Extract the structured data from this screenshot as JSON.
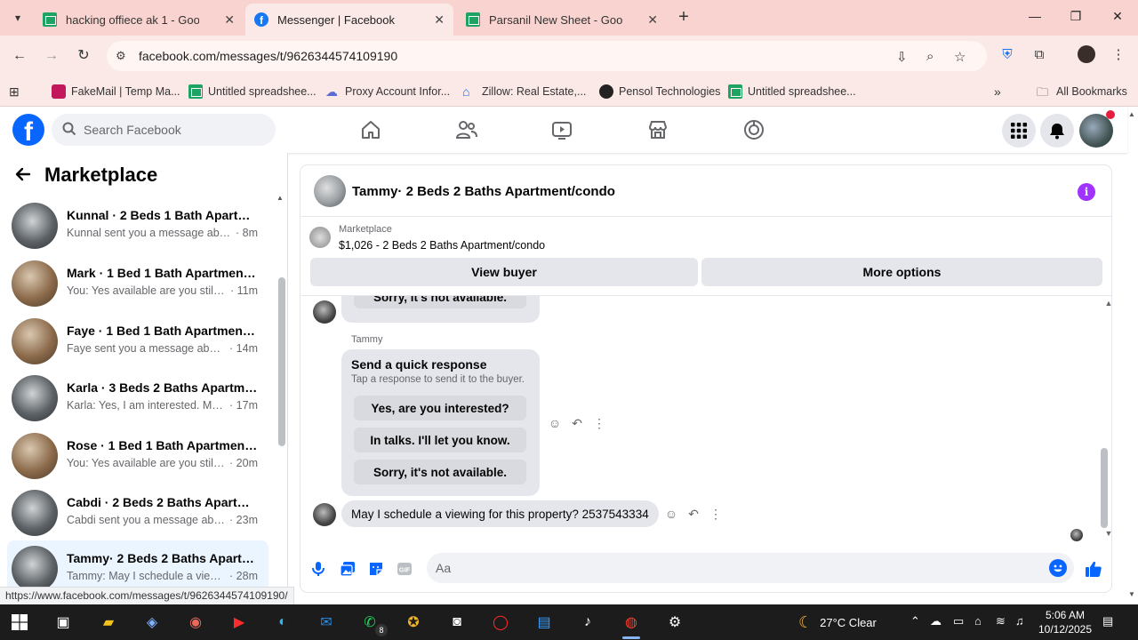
{
  "browser": {
    "tabs": [
      {
        "title": "hacking offiece ak 1 - Google Sh",
        "icon": "google-sheets-icon",
        "active": false
      },
      {
        "title": "Messenger | Facebook",
        "icon": "facebook-icon",
        "active": true
      },
      {
        "title": "Parsanil New Sheet - Google Sh",
        "icon": "google-sheets-icon",
        "active": false
      }
    ],
    "url": "facebook.com/messages/t/9626344574109190",
    "bookmarks": [
      {
        "label": "FakeMail | Temp Ma...",
        "icon": "fakemail-icon"
      },
      {
        "label": "Untitled spreadshee...",
        "icon": "google-sheets-icon"
      },
      {
        "label": "Proxy Account Infor...",
        "icon": "proxy-icon"
      },
      {
        "label": "Zillow: Real Estate,...",
        "icon": "zillow-icon"
      },
      {
        "label": "Pensol Technologies",
        "icon": "pensol-icon"
      },
      {
        "label": "Untitled spreadshee...",
        "icon": "google-sheets-icon"
      }
    ],
    "all_bookmarks": "All Bookmarks",
    "status_url": "https://www.facebook.com/messages/t/9626344574109190/"
  },
  "fb": {
    "search_placeholder": "Search Facebook",
    "logo": "f",
    "colors": {
      "brand": "#0866ff",
      "info": "#a033ff"
    }
  },
  "sidebar": {
    "title": "Marketplace",
    "conversations": [
      {
        "name": "Kunnal · 2 Beds 1 Bath Apartment/condo",
        "preview": "Kunnal sent you a message about ...",
        "time": "· 8m"
      },
      {
        "name": "Mark · 1 Bed 1 Bath Apartment/condo",
        "preview": "You: Yes available are you still int...",
        "time": "· 11m"
      },
      {
        "name": "Faye · 1 Bed 1 Bath Apartment/condo",
        "preview": "Faye sent you a message about y...",
        "time": "· 14m"
      },
      {
        "name": "Karla · 3 Beds 2 Baths Apartment/condo",
        "preview": "Karla: Yes, I am interested. My nu...",
        "time": "· 17m"
      },
      {
        "name": "Rose · 1 Bed 1 Bath Apartment/condo",
        "preview": "You: Yes available are you still int...",
        "time": "· 20m"
      },
      {
        "name": "Cabdi · 2 Beds 2 Baths Apartment/condo",
        "preview": "Cabdi sent you a message about ...",
        "time": "· 23m"
      },
      {
        "name": "Tammy· 2 Beds 2 Baths Apartment/condo",
        "preview": "Tammy: May I schedule a viewing...",
        "time": "· 28m"
      }
    ]
  },
  "chat": {
    "title": "Tammy· 2 Beds 2 Baths Apartment/condo",
    "listing_category": "Marketplace",
    "listing_title": "$1,026 - 2 Beds 2 Baths Apartment/condo",
    "view_buyer": "View buyer",
    "more_options": "More options",
    "prev_reply": "Sorry, it's not available.",
    "sender": "Tammy",
    "quick_title": "Send a quick response",
    "quick_sub": "Tap a response to send it to the buyer.",
    "quick_replies": [
      "Yes, are you interested?",
      "In talks. I'll let you know.",
      "Sorry, it's not available."
    ],
    "last_message": "May I schedule a viewing for this property? 2537543334",
    "composer_placeholder": "Aa"
  },
  "taskbar": {
    "weather": "27°C  Clear",
    "time": "5:06 AM",
    "date": "10/12/2025",
    "whatsapp_badge": "8"
  }
}
